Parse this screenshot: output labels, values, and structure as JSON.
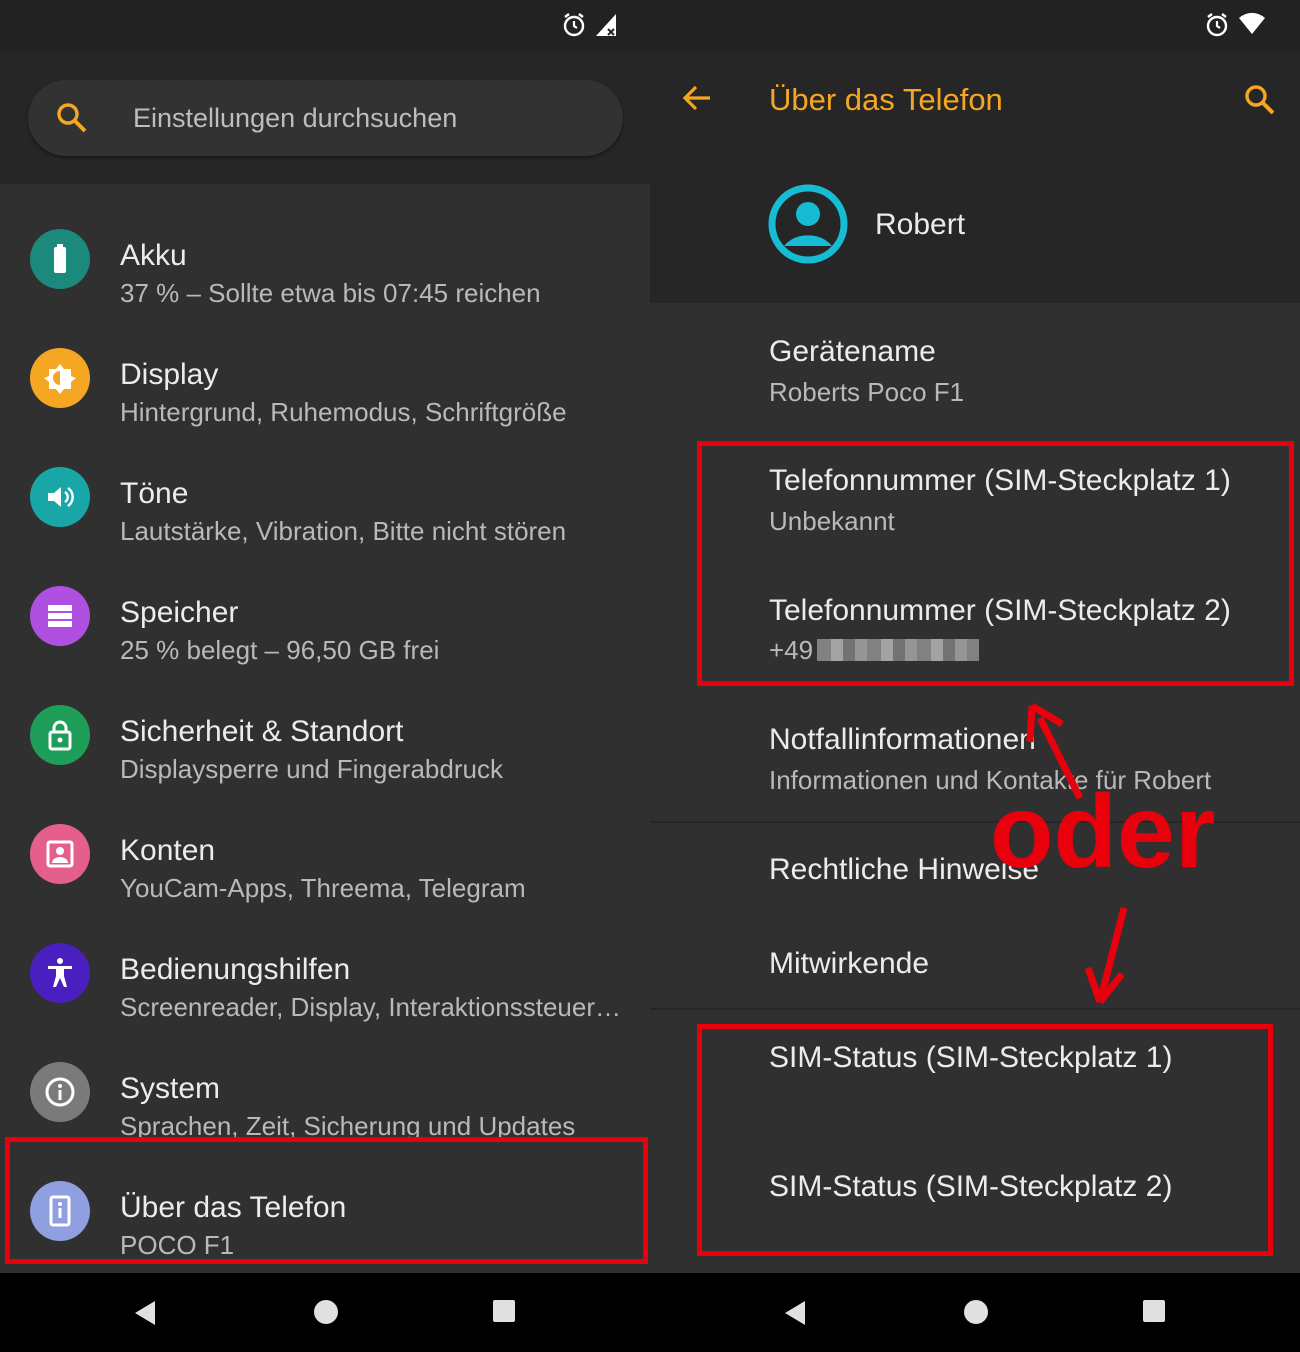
{
  "left": {
    "search_placeholder": "Einstellungen durchsuchen",
    "items": [
      {
        "title": "Akku",
        "sub": "37 % – Sollte etwa bis 07:45 reichen",
        "color": "#1b8a7d",
        "icon": "battery-icon"
      },
      {
        "title": "Display",
        "sub": "Hintergrund, Ruhemodus, Schriftgröße",
        "color": "#f5a623",
        "icon": "brightness-icon"
      },
      {
        "title": "Töne",
        "sub": "Lautstärke, Vibration, Bitte nicht stören",
        "color": "#19a6a6",
        "icon": "volume-icon"
      },
      {
        "title": "Speicher",
        "sub": "25 % belegt – 96,50 GB frei",
        "color": "#b050e0",
        "icon": "storage-icon"
      },
      {
        "title": "Sicherheit & Standort",
        "sub": "Displaysperre und Fingerabdruck",
        "color": "#1e9e58",
        "icon": "lock-icon"
      },
      {
        "title": "Konten",
        "sub": "YouCam-Apps, Threema, Telegram",
        "color": "#e45f8e",
        "icon": "account-box-icon"
      },
      {
        "title": "Bedienungshilfen",
        "sub": "Screenreader, Display, Interaktionssteuer…",
        "color": "#4a1fbf",
        "icon": "accessibility-icon"
      },
      {
        "title": "System",
        "sub": "Sprachen, Zeit, Sicherung und Updates",
        "color": "#7a7a7a",
        "icon": "info-icon"
      },
      {
        "title": "Über das Telefon",
        "sub": "POCO F1",
        "color": "#8f9fe0",
        "icon": "phone-info-icon"
      }
    ]
  },
  "right": {
    "title": "Über das Telefon",
    "user": "Robert",
    "device_name_title": "Gerätename",
    "device_name_value": "Roberts Poco F1",
    "phone1_title": "Telefonnummer (SIM-Steckplatz 1)",
    "phone1_value": "Unbekannt",
    "phone2_title": "Telefonnummer (SIM-Steckplatz 2)",
    "phone2_value": "+49",
    "emergency_title": "Notfallinformationen",
    "emergency_sub": "Informationen und Kontakte für Robert",
    "legal_title": "Rechtliche Hinweise",
    "contributors_title": "Mitwirkende",
    "sim1_title": "SIM-Status (SIM-Steckplatz 1)",
    "sim2_title": "SIM-Status (SIM-Steckplatz 2)",
    "annotation": "oder"
  },
  "colors": {
    "accent": "#f5a623",
    "annotation": "#e8000d",
    "avatar": "#16bcd4"
  }
}
